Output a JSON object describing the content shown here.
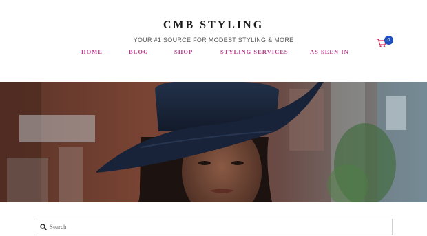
{
  "header": {
    "brand": "CMB STYLING",
    "tagline": "YOUR #1 SOURCE FOR MODEST STYLING & MORE"
  },
  "nav": {
    "items": [
      {
        "label": "HOME"
      },
      {
        "label": "BLOG"
      },
      {
        "label": "SHOP"
      },
      {
        "label": "STYLING SERVICES"
      },
      {
        "label": "AS SEEN IN"
      }
    ]
  },
  "cart": {
    "count": "0",
    "icon": "cart-icon"
  },
  "hero": {
    "image": "woman-in-wide-brim-hat-photo"
  },
  "search": {
    "placeholder": "Search",
    "value": "",
    "icon": "search-icon"
  },
  "colors": {
    "nav_accent": "#c0398f",
    "cart_accent": "#e0245e",
    "badge": "#1d4fbf"
  }
}
